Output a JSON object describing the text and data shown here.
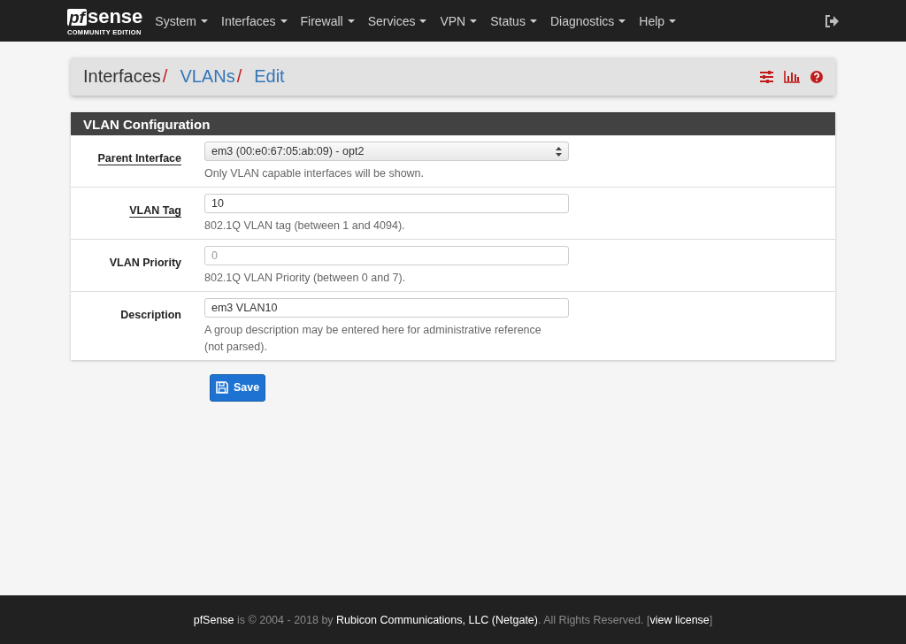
{
  "navbar": {
    "logo": {
      "mark": "pf",
      "word": "sense",
      "edition": "COMMUNITY EDITION"
    },
    "menus": [
      {
        "label": "System"
      },
      {
        "label": "Interfaces"
      },
      {
        "label": "Firewall"
      },
      {
        "label": "Services"
      },
      {
        "label": "VPN"
      },
      {
        "label": "Status"
      },
      {
        "label": "Diagnostics"
      },
      {
        "label": "Help"
      }
    ]
  },
  "breadcrumb": [
    {
      "label": "Interfaces",
      "link": false,
      "separator": "/"
    },
    {
      "label": "VLANs",
      "link": true,
      "separator": "/"
    },
    {
      "label": "Edit",
      "link": true
    }
  ],
  "panel": {
    "title": "VLAN Configuration",
    "rows": [
      {
        "label": "Parent Interface",
        "required": true,
        "kind": "select",
        "value": "em3 (00:e0:67:05:ab:09) - opt2",
        "help": "Only VLAN capable interfaces will be shown."
      },
      {
        "label": "VLAN Tag",
        "required": true,
        "kind": "input",
        "value": "10",
        "help": "802.1Q VLAN tag (between 1 and 4094)."
      },
      {
        "label": "VLAN Priority",
        "required": false,
        "kind": "input",
        "placeholder": "0",
        "help": "802.1Q VLAN Priority (between 0 and 7)."
      },
      {
        "label": "Description",
        "required": false,
        "kind": "input",
        "value": "em3 VLAN10",
        "help": "A group description may be entered here for administrative reference (not parsed)."
      }
    ]
  },
  "save_button": "Save",
  "footer": {
    "brand": "pfSense",
    "text1": " is © 2004 - 2018 by ",
    "company": "Rubicon Communications, LLC (Netgate)",
    "text2": ". All Rights Reserved. [",
    "link": "view license",
    "text3": "]"
  }
}
